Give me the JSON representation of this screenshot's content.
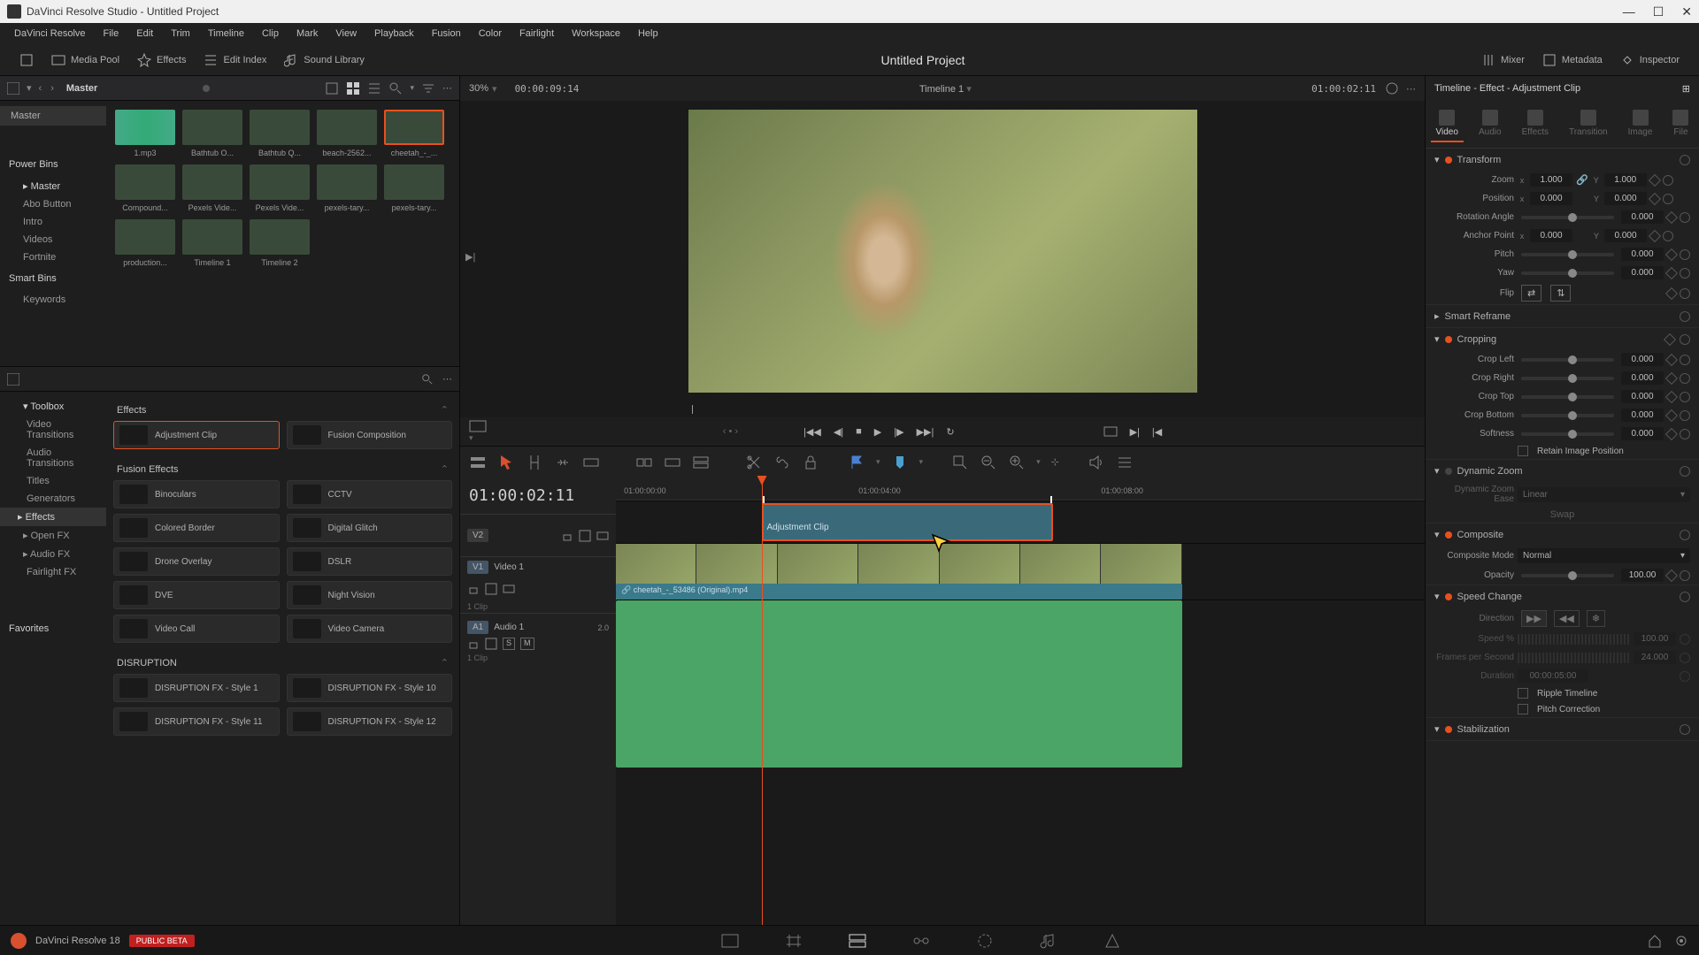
{
  "titlebar": {
    "title": "DaVinci Resolve Studio - Untitled Project"
  },
  "menu": [
    "DaVinci Resolve",
    "File",
    "Edit",
    "Trim",
    "Timeline",
    "Clip",
    "Mark",
    "View",
    "Playback",
    "Fusion",
    "Color",
    "Fairlight",
    "Workspace",
    "Help"
  ],
  "toolbar": {
    "mediaPool": "Media Pool",
    "effects": "Effects",
    "editIndex": "Edit Index",
    "soundLibrary": "Sound Library",
    "projectTitle": "Untitled Project",
    "mixer": "Mixer",
    "metadata": "Metadata",
    "inspector": "Inspector"
  },
  "bins": {
    "master": "Master",
    "sections": {
      "powerBins": "Power Bins",
      "smartBins": "Smart Bins",
      "favorites": "Favorites"
    },
    "items": [
      "Master",
      "Abo Button",
      "Intro",
      "Videos",
      "Fortnite"
    ],
    "smart": [
      "Keywords"
    ]
  },
  "thumbs": [
    {
      "label": "1.mp3",
      "green": true
    },
    {
      "label": "Bathtub O..."
    },
    {
      "label": "Bathtub Q..."
    },
    {
      "label": "beach-2562..."
    },
    {
      "label": "cheetah_-_...",
      "sel": true
    },
    {
      "label": "Compound..."
    },
    {
      "label": "Pexels Vide..."
    },
    {
      "label": "Pexels Vide..."
    },
    {
      "label": "pexels-tary..."
    },
    {
      "label": "pexels-tary..."
    },
    {
      "label": "production..."
    },
    {
      "label": "Timeline 1"
    },
    {
      "label": "Timeline 2"
    }
  ],
  "effectsTree": {
    "toolbox": "Toolbox",
    "items": [
      "Video Transitions",
      "Audio Transitions",
      "Titles",
      "Generators",
      "Effects"
    ],
    "openFX": "Open FX",
    "audioFX": "Audio FX",
    "fairlightFX": "Fairlight FX"
  },
  "effectsList": {
    "catEffects": "Effects",
    "effects": [
      "Adjustment Clip",
      "Fusion Composition"
    ],
    "catFusion": "Fusion Effects",
    "fusion": [
      "Binoculars",
      "CCTV",
      "Colored Border",
      "Digital Glitch",
      "Drone Overlay",
      "DSLR",
      "DVE",
      "Night Vision",
      "Video Call",
      "Video Camera"
    ],
    "catDisruption": "DISRUPTION",
    "disruption": [
      "DISRUPTION FX - Style 1",
      "DISRUPTION FX - Style 10",
      "DISRUPTION FX - Style 11",
      "DISRUPTION FX - Style 12"
    ]
  },
  "viewer": {
    "zoom": "30%",
    "tcLeft": "00:00:09:14",
    "timelineName": "Timeline 1",
    "tcRight": "01:00:02:11"
  },
  "timeline": {
    "tc": "01:00:02:11",
    "ruler": [
      "01:00:00:00",
      "01:00:04:00",
      "01:00:08:00"
    ],
    "v2": "V2",
    "v1": "V1",
    "video1": "Video 1",
    "a1": "A1",
    "audio1": "Audio 1",
    "audioGain": "2.0",
    "clip1": "1 Clip",
    "adjClipLabel": "Adjustment Clip",
    "audioFile": "cheetah_-_53486 (Original).mp4"
  },
  "inspector": {
    "title": "Timeline - Effect - Adjustment Clip",
    "tabs": [
      "Video",
      "Audio",
      "Effects",
      "Transition",
      "Image",
      "File"
    ],
    "transform": {
      "title": "Transform",
      "zoom": "Zoom",
      "zoomX": "1.000",
      "zoomY": "1.000",
      "position": "Position",
      "posX": "0.000",
      "posY": "0.000",
      "rotation": "Rotation Angle",
      "rotVal": "0.000",
      "anchor": "Anchor Point",
      "anchorX": "0.000",
      "anchorY": "0.000",
      "pitch": "Pitch",
      "pitchVal": "0.000",
      "yaw": "Yaw",
      "yawVal": "0.000",
      "flip": "Flip"
    },
    "smartReframe": "Smart Reframe",
    "cropping": {
      "title": "Cropping",
      "left": "Crop Left",
      "leftVal": "0.000",
      "right": "Crop Right",
      "rightVal": "0.000",
      "top": "Crop Top",
      "topVal": "0.000",
      "bottom": "Crop Bottom",
      "bottomVal": "0.000",
      "softness": "Softness",
      "softVal": "0.000",
      "retain": "Retain Image Position"
    },
    "dynamicZoom": {
      "title": "Dynamic Zoom",
      "ease": "Dynamic Zoom Ease",
      "easeVal": "Linear",
      "swap": "Swap"
    },
    "composite": {
      "title": "Composite",
      "mode": "Composite Mode",
      "modeVal": "Normal",
      "opacity": "Opacity",
      "opacityVal": "100.00"
    },
    "speedChange": {
      "title": "Speed Change",
      "direction": "Direction",
      "speed": "Speed %",
      "speedVal": "100.00",
      "fps": "Frames per Second",
      "fpsVal": "24.000",
      "duration": "Duration",
      "durVal": "00:00:05:00",
      "ripple": "Ripple Timeline",
      "pitch": "Pitch Correction"
    },
    "stabilization": "Stabilization"
  },
  "bottombar": {
    "version": "DaVinci Resolve 18",
    "beta": "PUBLIC BETA"
  }
}
